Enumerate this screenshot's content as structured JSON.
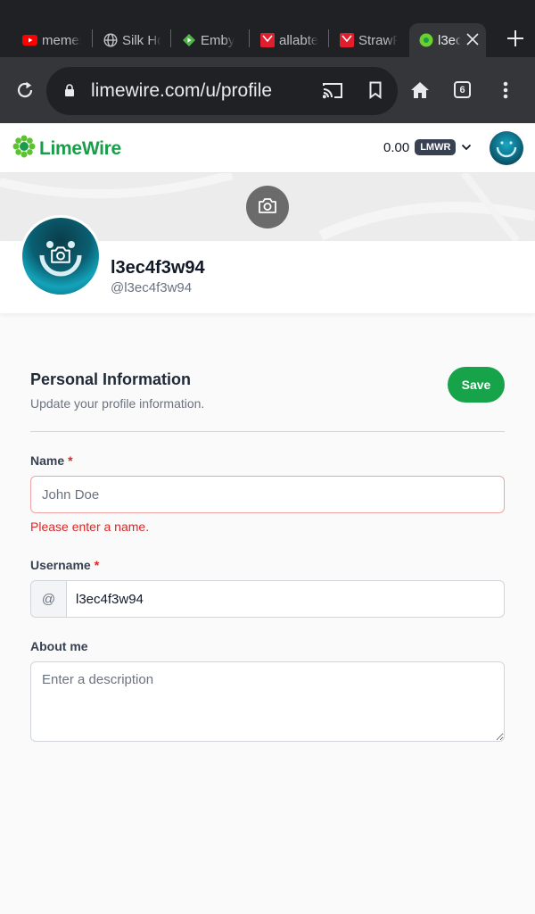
{
  "browser": {
    "tabs": [
      {
        "label": "memes",
        "icon": "youtube-icon"
      },
      {
        "label": "Silk Ho",
        "icon": "globe-icon"
      },
      {
        "label": "Emby",
        "icon": "emby-icon"
      },
      {
        "label": "allabte",
        "icon": "red-book-icon"
      },
      {
        "label": "StrawP",
        "icon": "red-book-icon"
      },
      {
        "label": "l3ec",
        "icon": "limewire-icon",
        "active": true
      }
    ],
    "url": "limewire.com/u/profile",
    "tab_count": "6"
  },
  "header": {
    "logo_text": "LimeWire",
    "balance": "0.00",
    "token": "LMWR"
  },
  "profile": {
    "display_name": "l3ec4f3w94",
    "handle": "@l3ec4f3w94"
  },
  "form": {
    "title": "Personal Information",
    "subtitle": "Update your profile information.",
    "save_label": "Save",
    "name_label": "Name",
    "required_mark": "*",
    "name_placeholder": "John Doe",
    "name_error": "Please enter a name.",
    "username_label": "Username",
    "username_prefix": "@",
    "username_value": "l3ec4f3w94",
    "about_label": "About me",
    "about_placeholder": "Enter a description"
  },
  "colors": {
    "accent": "#16a34a",
    "error": "#dc2626",
    "chrome_dark": "#202124"
  }
}
